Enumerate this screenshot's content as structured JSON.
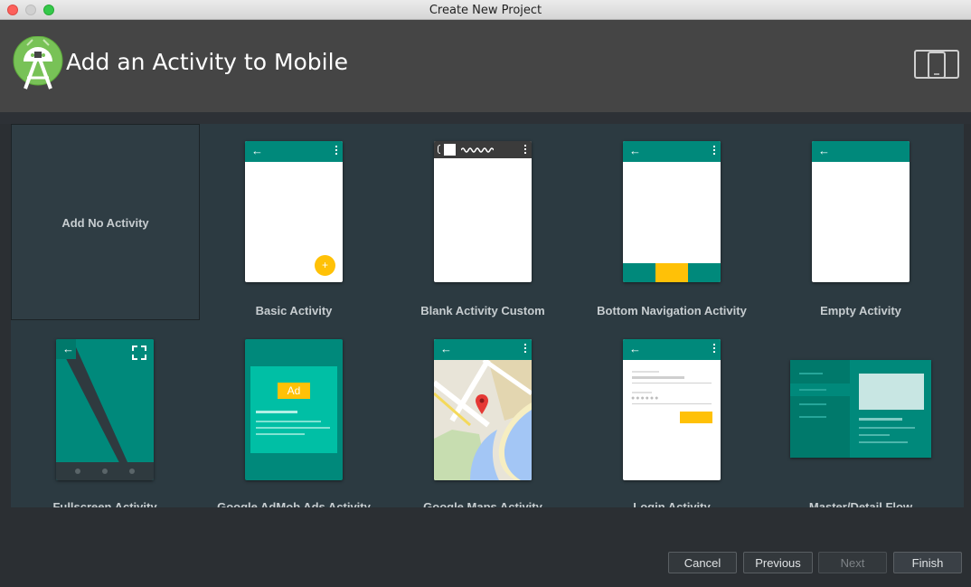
{
  "window": {
    "title": "Create New Project"
  },
  "header": {
    "title": "Add an Activity to Mobile"
  },
  "gallery": {
    "no_activity": "Add No Activity",
    "row1": [
      "Basic Activity",
      "Blank Activity Custom",
      "Bottom Navigation Activity",
      "Empty Activity"
    ],
    "row2": [
      "Fullscreen Activity",
      "Google AdMob Ads Activity",
      "Google Maps Activity",
      "Login Activity",
      "Master/Detail Flow"
    ],
    "ad_badge": "Ad"
  },
  "buttons": {
    "cancel": "Cancel",
    "previous": "Previous",
    "next": "Next",
    "finish": "Finish"
  },
  "colors": {
    "teal": "#00897b",
    "accent": "#ffc107",
    "header_bg": "#454545",
    "gallery_bg": "#2c3a41"
  }
}
